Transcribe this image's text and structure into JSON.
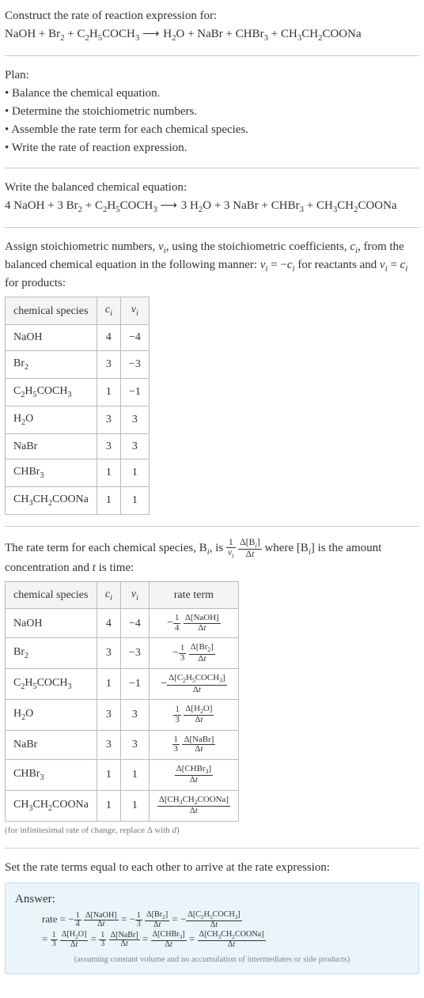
{
  "intro": {
    "title": "Construct the rate of reaction expression for:",
    "equation_html": "NaOH + Br<span class='sub'>2</span> + C<span class='sub'>2</span>H<span class='sub'>5</span>COCH<span class='sub'>3</span> <span class='arrow'>⟶</span> H<span class='sub'>2</span>O + NaBr + CHBr<span class='sub'>3</span> + CH<span class='sub'>3</span>CH<span class='sub'>2</span>COONa"
  },
  "plan": {
    "heading": "Plan:",
    "items": [
      "Balance the chemical equation.",
      "Determine the stoichiometric numbers.",
      "Assemble the rate term for each chemical species.",
      "Write the rate of reaction expression."
    ]
  },
  "balanced": {
    "heading": "Write the balanced chemical equation:",
    "equation_html": "4 NaOH + 3 Br<span class='sub'>2</span> + C<span class='sub'>2</span>H<span class='sub'>5</span>COCH<span class='sub'>3</span> <span class='arrow'>⟶</span> 3 H<span class='sub'>2</span>O + 3 NaBr + CHBr<span class='sub'>3</span> + CH<span class='sub'>3</span>CH<span class='sub'>2</span>COONa"
  },
  "assign": {
    "text_html": "Assign stoichiometric numbers, <i>ν<span class='sub'>i</span></i>, using the stoichiometric coefficients, <i>c<span class='sub'>i</span></i>, from the balanced chemical equation in the following manner: <i>ν<span class='sub'>i</span></i> = −<i>c<span class='sub'>i</span></i> for reactants and <i>ν<span class='sub'>i</span></i> = <i>c<span class='sub'>i</span></i> for products:"
  },
  "table1": {
    "headers": {
      "species": "chemical species",
      "c": "c",
      "nu": "ν"
    },
    "rows": [
      {
        "species_html": "NaOH",
        "c": "4",
        "nu": "−4"
      },
      {
        "species_html": "Br<span class='sub'>2</span>",
        "c": "3",
        "nu": "−3"
      },
      {
        "species_html": "C<span class='sub'>2</span>H<span class='sub'>5</span>COCH<span class='sub'>3</span>",
        "c": "1",
        "nu": "−1"
      },
      {
        "species_html": "H<span class='sub'>2</span>O",
        "c": "3",
        "nu": "3"
      },
      {
        "species_html": "NaBr",
        "c": "3",
        "nu": "3"
      },
      {
        "species_html": "CHBr<span class='sub'>3</span>",
        "c": "1",
        "nu": "1"
      },
      {
        "species_html": "CH<span class='sub'>3</span>CH<span class='sub'>2</span>COONa",
        "c": "1",
        "nu": "1"
      }
    ]
  },
  "rate_term_intro": {
    "text_html": "The rate term for each chemical species, B<span class='sub'><i>i</i></span>, is <span class='frac'><span class='num'>1</span><span class='den'><i>ν<span class='sub'>i</span></i></span></span> <span class='frac'><span class='num'>Δ[B<span class='sub'><i>i</i></span>]</span><span class='den'>Δ<i>t</i></span></span> where [B<span class='sub'><i>i</i></span>] is the amount concentration and <i>t</i> is time:"
  },
  "table2": {
    "headers": {
      "species": "chemical species",
      "c": "c",
      "nu": "ν",
      "rate": "rate term"
    },
    "rows": [
      {
        "species_html": "NaOH",
        "c": "4",
        "nu": "−4",
        "rate_html": "−<span class='frac'><span class='num'>1</span><span class='den'>4</span></span> <span class='frac'><span class='num'>Δ[NaOH]</span><span class='den'>Δ<i>t</i></span></span>"
      },
      {
        "species_html": "Br<span class='sub'>2</span>",
        "c": "3",
        "nu": "−3",
        "rate_html": "−<span class='frac'><span class='num'>1</span><span class='den'>3</span></span> <span class='frac'><span class='num'>Δ[Br<span class='sub'>2</span>]</span><span class='den'>Δ<i>t</i></span></span>"
      },
      {
        "species_html": "C<span class='sub'>2</span>H<span class='sub'>5</span>COCH<span class='sub'>3</span>",
        "c": "1",
        "nu": "−1",
        "rate_html": "−<span class='frac'><span class='num'>Δ[C<span class='sub'>2</span>H<span class='sub'>5</span>COCH<span class='sub'>3</span>]</span><span class='den'>Δ<i>t</i></span></span>"
      },
      {
        "species_html": "H<span class='sub'>2</span>O",
        "c": "3",
        "nu": "3",
        "rate_html": "<span class='frac'><span class='num'>1</span><span class='den'>3</span></span> <span class='frac'><span class='num'>Δ[H<span class='sub'>2</span>O]</span><span class='den'>Δ<i>t</i></span></span>"
      },
      {
        "species_html": "NaBr",
        "c": "3",
        "nu": "3",
        "rate_html": "<span class='frac'><span class='num'>1</span><span class='den'>3</span></span> <span class='frac'><span class='num'>Δ[NaBr]</span><span class='den'>Δ<i>t</i></span></span>"
      },
      {
        "species_html": "CHBr<span class='sub'>3</span>",
        "c": "1",
        "nu": "1",
        "rate_html": "<span class='frac'><span class='num'>Δ[CHBr<span class='sub'>3</span>]</span><span class='den'>Δ<i>t</i></span></span>"
      },
      {
        "species_html": "CH<span class='sub'>3</span>CH<span class='sub'>2</span>COONa",
        "c": "1",
        "nu": "1",
        "rate_html": "<span class='frac'><span class='num'>Δ[CH<span class='sub'>3</span>CH<span class='sub'>2</span>COONa]</span><span class='den'>Δ<i>t</i></span></span>"
      }
    ],
    "note_html": "(for infinitesimal rate of change, replace Δ with <i>d</i>)"
  },
  "set_equal": "Set the rate terms equal to each other to arrive at the rate expression:",
  "answer": {
    "label": "Answer:",
    "line1_html": "rate = −<span class='frac'><span class='num'>1</span><span class='den'>4</span></span> <span class='frac'><span class='num'>Δ[NaOH]</span><span class='den'>Δ<i>t</i></span></span> = −<span class='frac'><span class='num'>1</span><span class='den'>3</span></span> <span class='frac'><span class='num'>Δ[Br<span class='sub'>2</span>]</span><span class='den'>Δ<i>t</i></span></span> = −<span class='frac'><span class='num'>Δ[C<span class='sub'>2</span>H<span class='sub'>5</span>COCH<span class='sub'>3</span>]</span><span class='den'>Δ<i>t</i></span></span>",
    "line2_html": "= <span class='frac'><span class='num'>1</span><span class='den'>3</span></span> <span class='frac'><span class='num'>Δ[H<span class='sub'>2</span>O]</span><span class='den'>Δ<i>t</i></span></span> = <span class='frac'><span class='num'>1</span><span class='den'>3</span></span> <span class='frac'><span class='num'>Δ[NaBr]</span><span class='den'>Δ<i>t</i></span></span> = <span class='frac'><span class='num'>Δ[CHBr<span class='sub'>3</span>]</span><span class='den'>Δ<i>t</i></span></span> = <span class='frac'><span class='num'>Δ[CH<span class='sub'>3</span>CH<span class='sub'>2</span>COONa]</span><span class='den'>Δ<i>t</i></span></span>",
    "note": "(assuming constant volume and no accumulation of intermediates or side products)"
  },
  "chart_data": {
    "type": "table",
    "title": "Stoichiometric coefficients, numbers, and rate terms",
    "columns": [
      "chemical species",
      "c_i",
      "ν_i",
      "rate term"
    ],
    "rows": [
      [
        "NaOH",
        4,
        -4,
        "-(1/4) Δ[NaOH]/Δt"
      ],
      [
        "Br2",
        3,
        -3,
        "-(1/3) Δ[Br2]/Δt"
      ],
      [
        "C2H5COCH3",
        1,
        -1,
        "-Δ[C2H5COCH3]/Δt"
      ],
      [
        "H2O",
        3,
        3,
        "(1/3) Δ[H2O]/Δt"
      ],
      [
        "NaBr",
        3,
        3,
        "(1/3) Δ[NaBr]/Δt"
      ],
      [
        "CHBr3",
        1,
        1,
        "Δ[CHBr3]/Δt"
      ],
      [
        "CH3CH2COONa",
        1,
        1,
        "Δ[CH3CH2COONa]/Δt"
      ]
    ]
  }
}
